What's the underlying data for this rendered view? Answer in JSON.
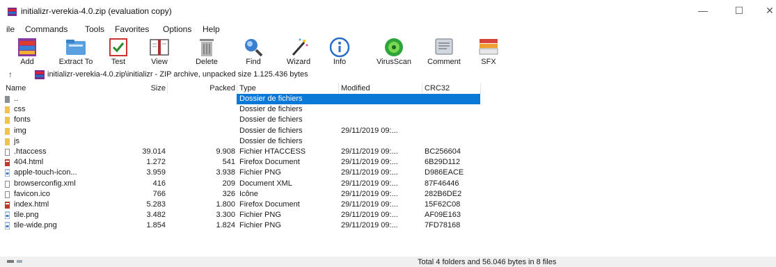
{
  "window": {
    "title": "initializr-verekia-4.0.zip (evaluation copy)",
    "controls": [
      "—",
      "☐",
      "✕"
    ]
  },
  "menu": [
    "ile",
    "Commands",
    "Tools",
    "Favorites",
    "Options",
    "Help"
  ],
  "toolbar": [
    {
      "label": "Add",
      "icon": "add-archive-icon"
    },
    {
      "label": "Extract To",
      "icon": "extract-folder-icon"
    },
    {
      "label": "Test",
      "icon": "test-check-icon"
    },
    {
      "label": "View",
      "icon": "view-book-icon"
    },
    {
      "label": "Delete",
      "icon": "trash-icon"
    },
    {
      "label": "Find",
      "icon": "magnifier-icon"
    },
    {
      "label": "Wizard",
      "icon": "magic-wand-icon"
    },
    {
      "label": "Info",
      "icon": "info-icon"
    },
    {
      "label": "VirusScan",
      "icon": "virus-scan-icon"
    },
    {
      "label": "Comment",
      "icon": "comment-icon"
    },
    {
      "label": "SFX",
      "icon": "sfx-archive-icon"
    }
  ],
  "path": {
    "text": "initializr-verekia-4.0.zip\\initializr - ZIP archive, unpacked size 1.125.436 bytes"
  },
  "columns": {
    "name": "Name",
    "size": "Size",
    "packed": "Packed",
    "type": "Type",
    "modified": "Modified",
    "crc": "CRC32"
  },
  "files": [
    {
      "name": "..",
      "size": "",
      "packed": "",
      "type": "Dossier de fichiers",
      "modified": "",
      "crc": "",
      "kind": "parent"
    },
    {
      "name": "css",
      "size": "",
      "packed": "",
      "type": "Dossier de fichiers",
      "modified": "",
      "crc": "",
      "kind": "folder"
    },
    {
      "name": "fonts",
      "size": "",
      "packed": "",
      "type": "Dossier de fichiers",
      "modified": "",
      "crc": "",
      "kind": "folder"
    },
    {
      "name": "img",
      "size": "",
      "packed": "",
      "type": "Dossier de fichiers",
      "modified": "29/11/2019 09:...",
      "crc": "",
      "kind": "folder"
    },
    {
      "name": "js",
      "size": "",
      "packed": "",
      "type": "Dossier de fichiers",
      "modified": "",
      "crc": "",
      "kind": "folder"
    },
    {
      "name": ".htaccess",
      "size": "39.014",
      "packed": "9.908",
      "type": "Fichier HTACCESS",
      "modified": "29/11/2019 09:...",
      "crc": "BC256604",
      "kind": "file"
    },
    {
      "name": "404.html",
      "size": "1.272",
      "packed": "541",
      "type": "Firefox Document",
      "modified": "29/11/2019 09:...",
      "crc": "6B29D112",
      "kind": "html"
    },
    {
      "name": "apple-touch-icon...",
      "size": "3.959",
      "packed": "3.938",
      "type": "Fichier PNG",
      "modified": "29/11/2019 09:...",
      "crc": "D986EACE",
      "kind": "image"
    },
    {
      "name": "browserconfig.xml",
      "size": "416",
      "packed": "209",
      "type": "Document XML",
      "modified": "29/11/2019 09:...",
      "crc": "87F46446",
      "kind": "file"
    },
    {
      "name": "favicon.ico",
      "size": "766",
      "packed": "326",
      "type": "Icône",
      "modified": "29/11/2019 09:...",
      "crc": "282B6DE2",
      "kind": "file"
    },
    {
      "name": "index.html",
      "size": "5.283",
      "packed": "1.800",
      "type": "Firefox Document",
      "modified": "29/11/2019 09:...",
      "crc": "15F62C08",
      "kind": "html"
    },
    {
      "name": "tile.png",
      "size": "3.482",
      "packed": "3.300",
      "type": "Fichier PNG",
      "modified": "29/11/2019 09:...",
      "crc": "AF09E163",
      "kind": "image"
    },
    {
      "name": "tile-wide.png",
      "size": "1.854",
      "packed": "1.824",
      "type": "Fichier PNG",
      "modified": "29/11/2019 09:...",
      "crc": "7FD78168",
      "kind": "image"
    }
  ],
  "status": {
    "text": "Total 4 folders and 56.046 bytes in 8 files"
  },
  "colors": {
    "selection": "#0a78d7",
    "folder": "#f2c14e"
  }
}
